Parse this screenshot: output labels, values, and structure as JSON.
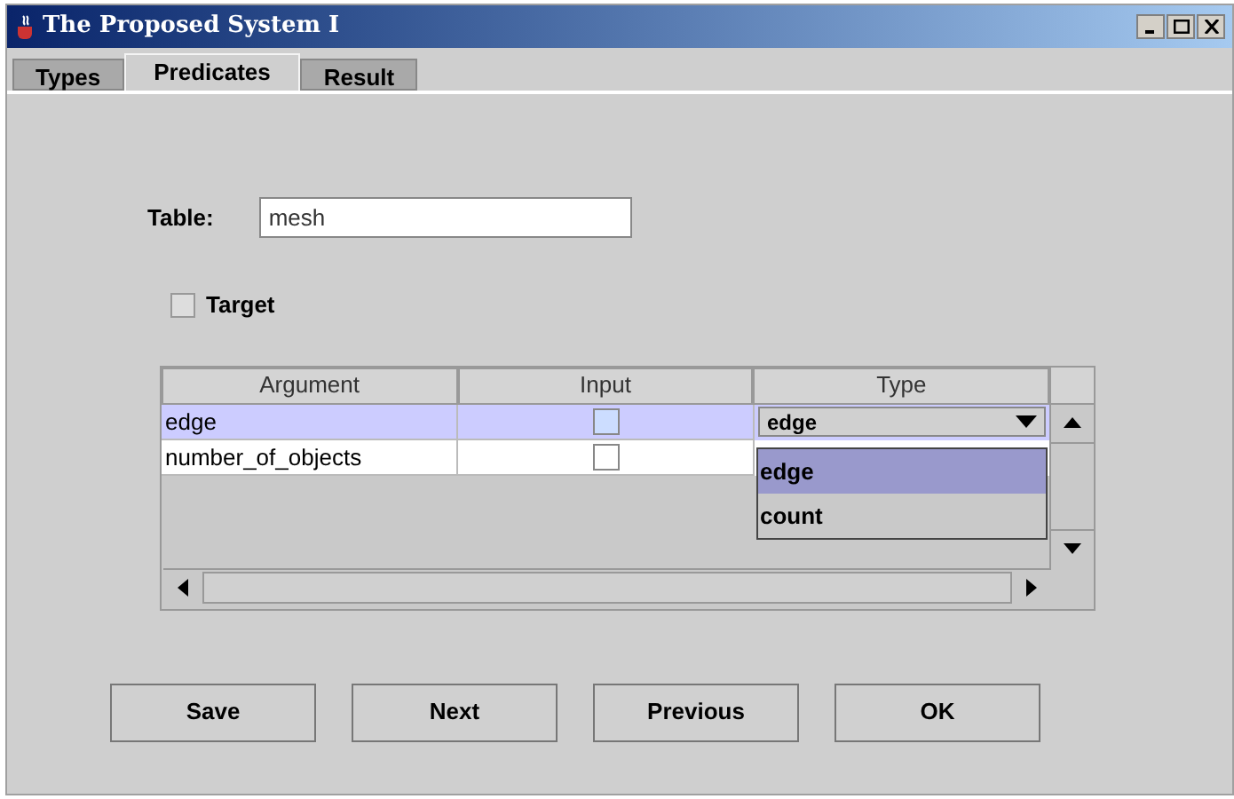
{
  "window": {
    "title": "The Proposed System I"
  },
  "tabs": [
    {
      "label": "Types",
      "selected": false
    },
    {
      "label": "Predicates",
      "selected": true
    },
    {
      "label": "Result",
      "selected": false
    }
  ],
  "table_field": {
    "label": "Table:",
    "value": "mesh"
  },
  "target": {
    "label": "Target",
    "checked": false
  },
  "grid": {
    "columns": [
      "Argument",
      "Input",
      "Type"
    ],
    "rows": [
      {
        "argument": "edge",
        "input": false,
        "selected": true,
        "type": "edge"
      },
      {
        "argument": "number_of_objects",
        "input": false,
        "selected": false
      }
    ],
    "dropdown": [
      {
        "label": "edge",
        "selected": true
      },
      {
        "label": "count",
        "selected": false
      }
    ]
  },
  "buttons": [
    "Save",
    "Next",
    "Previous",
    "OK"
  ]
}
